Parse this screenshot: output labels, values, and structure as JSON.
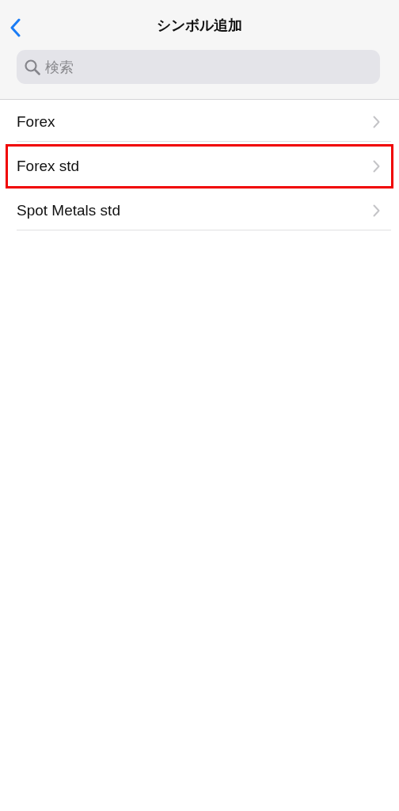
{
  "nav": {
    "title": "シンボル追加"
  },
  "search": {
    "placeholder": "検索"
  },
  "items": [
    {
      "label": "Forex",
      "highlighted": false
    },
    {
      "label": "Forex std",
      "highlighted": true
    },
    {
      "label": "Spot Metals std",
      "highlighted": false
    }
  ]
}
